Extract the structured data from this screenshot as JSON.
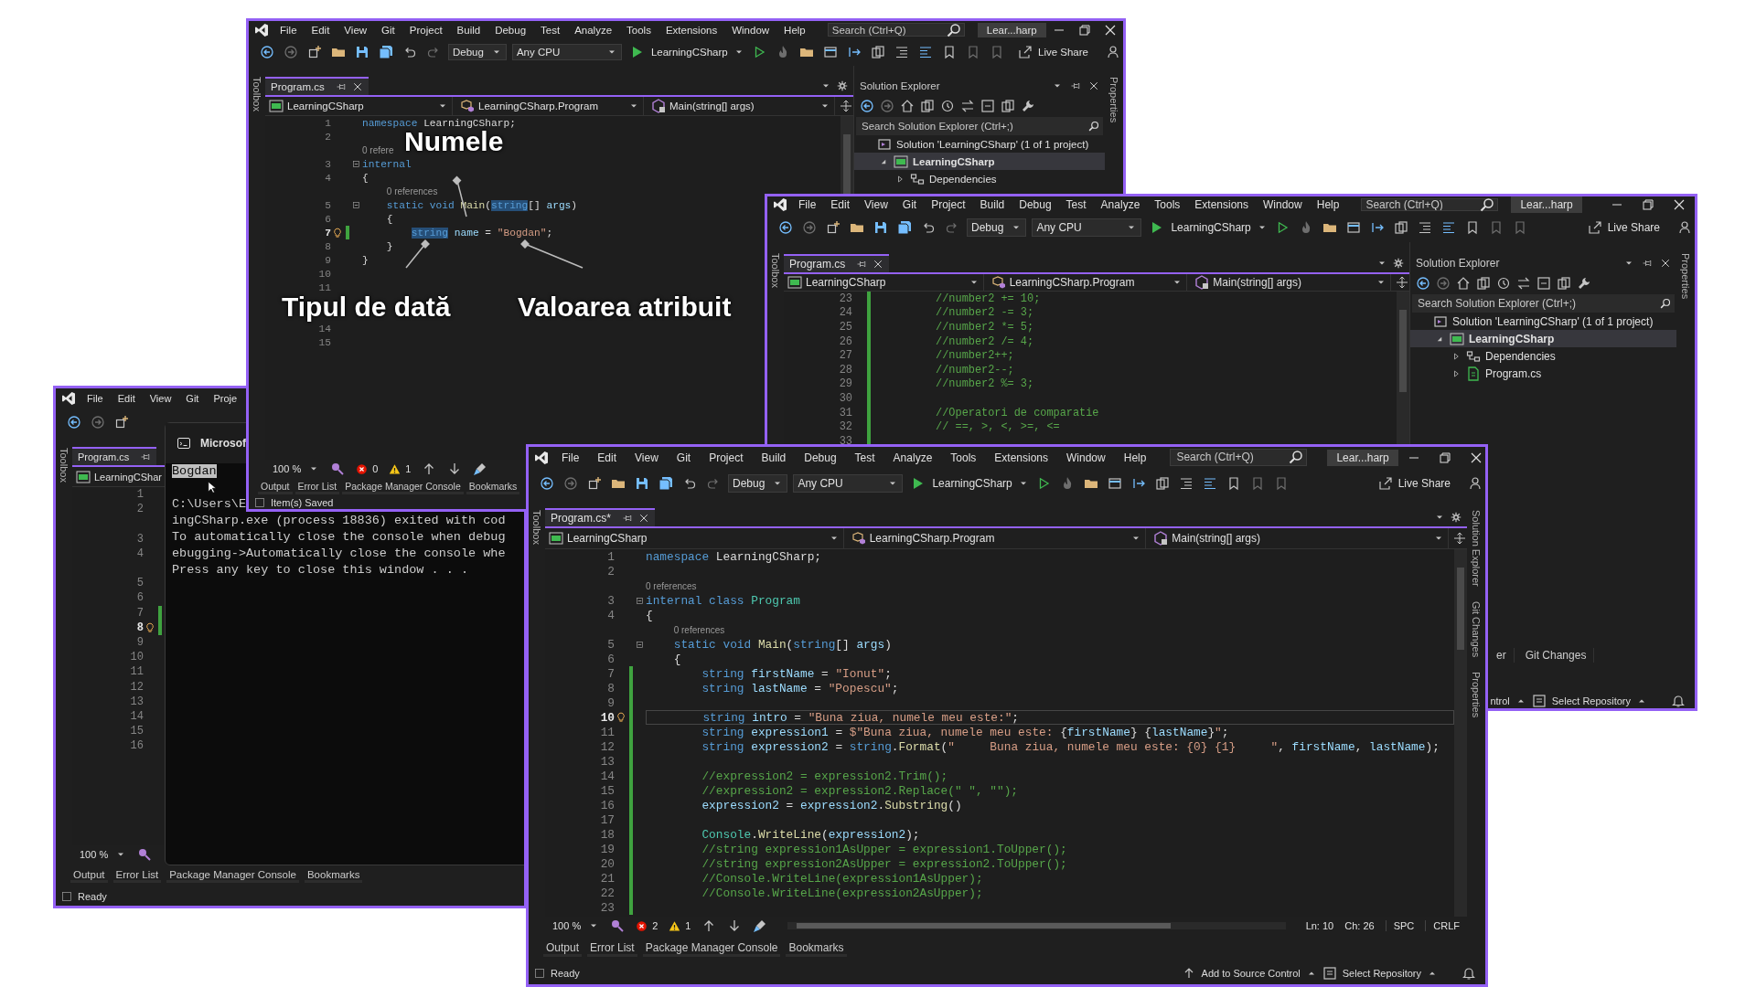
{
  "windows": [
    {
      "focused": false,
      "menu": [
        "File",
        "Edit",
        "View",
        "Git",
        "Project",
        "Build",
        "Debug",
        "Test",
        "Analyze",
        "Tools",
        "Extensions",
        "Window",
        "Help"
      ],
      "search_placeholder": "Search (Ctrl+Q)",
      "solution_name": "Lear...harp",
      "toolbar": {
        "configuration": "Debug",
        "platform": "Any CPU",
        "startup_project": "LearningCSharp",
        "live_share": "Live Share"
      },
      "left_strip": [
        "Toolbox"
      ],
      "right_strip": [
        "Properties"
      ],
      "document_tab": "Program.cs",
      "nav": [
        "LearningCSharp",
        "LearningCSharp.Program",
        "Main(string[] args)"
      ],
      "code": [
        {
          "num": "1",
          "code": [
            {
              "text": "namespace",
              "kind": "keyword"
            },
            {
              "text": " LearningCSharp;",
              "kind": "plain"
            }
          ],
          "changed": false
        },
        {
          "num": "2",
          "changed": false
        },
        {
          "lens": "0 refere"
        },
        {
          "num": "3",
          "code": [
            {
              "text": "internal",
              "kind": "keyword"
            }
          ],
          "fold": true,
          "changed": false
        },
        {
          "num": "4",
          "code": [
            {
              "text": "{",
              "kind": "plain"
            }
          ],
          "changed": false
        },
        {
          "lens": "0 references"
        },
        {
          "num": "5",
          "code": [
            {
              "text": "    static void ",
              "kind": "keyword"
            },
            {
              "text": "Main",
              "kind": "method"
            },
            {
              "text": "(",
              "kind": "plain"
            },
            {
              "text": "string",
              "kind": "highlight"
            },
            {
              "text": "[] ",
              "kind": "plain"
            },
            {
              "text": "args",
              "kind": "variable"
            },
            {
              "text": ")",
              "kind": "plain"
            }
          ],
          "fold": true,
          "changed": false
        },
        {
          "num": "6",
          "code": [
            {
              "text": "    {",
              "kind": "plain"
            }
          ],
          "changed": false
        },
        {
          "num": "7",
          "code": [
            {
              "text": "        string",
              "kind": "highlight"
            },
            {
              "text": " name",
              "kind": "variable"
            },
            {
              "text": " = ",
              "kind": "plain"
            },
            {
              "text": "\"Bogdan\"",
              "kind": "string"
            },
            {
              "text": ";",
              "kind": "plain"
            }
          ],
          "bulb": true,
          "current": true,
          "changed": true
        },
        {
          "num": "8",
          "code": [
            {
              "text": "    }",
              "kind": "plain"
            }
          ],
          "changed": false
        },
        {
          "num": "9",
          "code": [
            {
              "text": "}",
              "kind": "plain"
            }
          ],
          "changed": false
        },
        {
          "num": "10",
          "changed": false
        },
        {
          "num": "11",
          "changed": false
        },
        {
          "changed": false
        },
        {
          "changed": false
        },
        {
          "num": "14",
          "changed": false
        },
        {
          "num": "15",
          "changed": false
        }
      ],
      "editor_status": {
        "zoom": "100 %",
        "errors": "0",
        "warnings": "1"
      },
      "bottom_tabs": [
        "Output",
        "Error List",
        "Package Manager Console",
        "Bookmarks"
      ],
      "status_bar": {
        "message": "Item(s) Saved"
      },
      "solution_explorer": {
        "title": "Solution Explorer",
        "search_placeholder": "Search Solution Explorer (Ctrl+;)",
        "tree": [
          {
            "label": "Solution 'LearningCSharp' (1 of 1 project)",
            "kind": "solution",
            "selected": false,
            "children": [
              {
                "label": "LearningCSharp",
                "kind": "project",
                "selected": true,
                "expanded": true,
                "children": [
                  {
                    "label": "Dependencies",
                    "kind": "dependencies",
                    "selected": false,
                    "expanded": false
                  }
                ]
              }
            ]
          }
        ]
      },
      "annotations": [
        "Numele",
        "Tipul de dată",
        "Valoarea atribuit"
      ]
    },
    {
      "focused": false,
      "menu": [
        "File",
        "Edit",
        "View",
        "Git",
        "Project",
        "Build",
        "Debug",
        "Test",
        "Analyze",
        "Tools",
        "Extensions",
        "Window",
        "Help"
      ],
      "search_placeholder": "Search (Ctrl+Q)",
      "solution_name": "Lear...harp",
      "toolbar": {
        "configuration": "Debug",
        "platform": "Any CPU",
        "startup_project": "LearningCSharp",
        "live_share": "Live Share"
      },
      "left_strip": [
        "Toolbox"
      ],
      "right_strip": [
        "Properties"
      ],
      "document_tab": "Program.cs",
      "nav": [
        "LearningCSharp",
        "LearningCSharp.Program",
        "Main(string[] args)"
      ],
      "code": [
        {
          "num": "23",
          "code": [
            {
              "text": "        //number2 += 10;",
              "kind": "comment"
            }
          ],
          "changed": true
        },
        {
          "num": "24",
          "code": [
            {
              "text": "        //number2 -= 3;",
              "kind": "comment"
            }
          ],
          "changed": true
        },
        {
          "num": "25",
          "code": [
            {
              "text": "        //number2 *= 5;",
              "kind": "comment"
            }
          ],
          "changed": true
        },
        {
          "num": "26",
          "code": [
            {
              "text": "        //number2 /= 4;",
              "kind": "comment"
            }
          ],
          "changed": true
        },
        {
          "num": "27",
          "code": [
            {
              "text": "        //number2++;",
              "kind": "comment"
            }
          ],
          "changed": true
        },
        {
          "num": "28",
          "code": [
            {
              "text": "        //number2--;",
              "kind": "comment"
            }
          ],
          "changed": true
        },
        {
          "num": "29",
          "code": [
            {
              "text": "        //number2 %= 3;",
              "kind": "comment"
            }
          ],
          "changed": true
        },
        {
          "num": "30",
          "changed": true
        },
        {
          "num": "31",
          "code": [
            {
              "text": "        //Operatori de comparatie",
              "kind": "comment"
            }
          ],
          "changed": true
        },
        {
          "num": "32",
          "code": [
            {
              "text": "        // ==, >, <, >=, <=",
              "kind": "comment"
            }
          ],
          "changed": true
        },
        {
          "num": "33",
          "changed": true
        }
      ],
      "status_bar": {
        "items": [
          {
            "text": "ntrol",
            "kind": "truncated"
          },
          {
            "text": "Select Repository",
            "kind": "repository"
          }
        ]
      },
      "solution_explorer": {
        "title": "Solution Explorer",
        "search_placeholder": "Search Solution Explorer (Ctrl+;)",
        "tree": [
          {
            "label": "Solution 'LearningCSharp' (1 of 1 project)",
            "kind": "solution",
            "selected": false,
            "children": [
              {
                "label": "LearningCSharp",
                "kind": "project",
                "selected": true,
                "expanded": true,
                "children": [
                  {
                    "label": "Dependencies",
                    "kind": "dependencies",
                    "selected": false,
                    "expanded": false
                  },
                  {
                    "label": "Program.cs",
                    "kind": "file",
                    "selected": false,
                    "expanded": false
                  }
                ]
              }
            ]
          }
        ],
        "bottom_tabs": [
          "er",
          "Git Changes"
        ]
      }
    },
    {
      "focused": false,
      "menu": [
        "File",
        "Edit",
        "View",
        "Git",
        "Proje"
      ],
      "left_strip": [
        "Toolbox"
      ],
      "document_tab": "Program.cs",
      "nav": [
        "LearningCShar"
      ],
      "code": [
        {
          "num": "1",
          "changed": false
        },
        {
          "num": "2",
          "changed": false
        },
        {
          "changed": false
        },
        {
          "num": "3",
          "changed": false
        },
        {
          "num": "4",
          "changed": false
        },
        {
          "changed": false
        },
        {
          "num": "5",
          "changed": false
        },
        {
          "num": "6",
          "changed": false
        },
        {
          "num": "7",
          "changed": true
        },
        {
          "num": "8",
          "changed": true,
          "bulb": true,
          "current": true
        },
        {
          "num": "9",
          "changed": false
        },
        {
          "num": "10",
          "changed": false
        },
        {
          "num": "11",
          "changed": false
        },
        {
          "num": "12",
          "changed": false
        },
        {
          "num": "13",
          "changed": false
        },
        {
          "num": "14",
          "changed": false
        },
        {
          "num": "15",
          "changed": false
        },
        {
          "num": "16",
          "changed": false
        }
      ],
      "editor_status": {
        "zoom": "100 %"
      },
      "bottom_tabs": [
        "Output",
        "Error List",
        "Package Manager Console",
        "Bookmarks"
      ],
      "status_bar": {
        "message": "Ready"
      },
      "console": {
        "title": "Microsof",
        "lines": [
          {
            "text": "Bogdan",
            "selected": true
          },
          {
            "text": "C:\\Users\\E",
            "selected": false
          },
          {
            "text": "ingCSharp.exe (process 18836) exited with cod",
            "selected": false
          },
          {
            "text": "To automatically close the console when debug",
            "selected": false
          },
          {
            "text": "ebugging->Automatically close the console whe",
            "selected": false
          },
          {
            "text": "Press any key to close this window . . .",
            "selected": false
          }
        ]
      }
    },
    {
      "focused": true,
      "menu": [
        "File",
        "Edit",
        "View",
        "Git",
        "Project",
        "Build",
        "Debug",
        "Test",
        "Analyze",
        "Tools",
        "Extensions",
        "Window",
        "Help"
      ],
      "search_placeholder": "Search (Ctrl+Q)",
      "solution_name": "Lear...harp",
      "toolbar": {
        "configuration": "Debug",
        "platform": "Any CPU",
        "startup_project": "LearningCSharp",
        "live_share": "Live Share"
      },
      "left_strip": [
        "Toolbox"
      ],
      "right_strip": [
        "Solution Explorer",
        "Git Changes",
        "Properties"
      ],
      "document_tab": "Program.cs*",
      "nav": [
        "LearningCSharp",
        "LearningCSharp.Program",
        "Main(string[] args)"
      ],
      "code": [
        {
          "num": "1",
          "code": [
            {
              "text": "namespace",
              "kind": "keyword"
            },
            {
              "text": " LearningCSharp;",
              "kind": "plain"
            }
          ],
          "changed": false
        },
        {
          "num": "2",
          "changed": false
        },
        {
          "lens": "0 references"
        },
        {
          "num": "3",
          "code": [
            {
              "text": "internal class ",
              "kind": "keyword"
            },
            {
              "text": "Program",
              "kind": "type"
            }
          ],
          "fold": true,
          "changed": false
        },
        {
          "num": "4",
          "code": [
            {
              "text": "{",
              "kind": "plain"
            }
          ],
          "changed": false
        },
        {
          "lens": "0 references"
        },
        {
          "num": "5",
          "code": [
            {
              "text": "    static void ",
              "kind": "keyword"
            },
            {
              "text": "Main",
              "kind": "method"
            },
            {
              "text": "(",
              "kind": "plain"
            },
            {
              "text": "string",
              "kind": "keyword"
            },
            {
              "text": "[] ",
              "kind": "plain"
            },
            {
              "text": "args",
              "kind": "variable"
            },
            {
              "text": ")",
              "kind": "plain"
            }
          ],
          "fold": true,
          "changed": false
        },
        {
          "num": "6",
          "code": [
            {
              "text": "    {",
              "kind": "plain"
            }
          ],
          "changed": false
        },
        {
          "num": "7",
          "code": [
            {
              "text": "        string",
              "kind": "keyword"
            },
            {
              "text": " firstName",
              "kind": "variable"
            },
            {
              "text": " = ",
              "kind": "plain"
            },
            {
              "text": "\"Ionut\"",
              "kind": "string"
            },
            {
              "text": ";",
              "kind": "plain"
            }
          ],
          "changed": true
        },
        {
          "num": "8",
          "code": [
            {
              "text": "        string",
              "kind": "keyword"
            },
            {
              "text": " lastName",
              "kind": "variable"
            },
            {
              "text": " = ",
              "kind": "plain"
            },
            {
              "text": "\"Popescu\"",
              "kind": "string"
            },
            {
              "text": ";",
              "kind": "plain"
            }
          ],
          "changed": true
        },
        {
          "num": "9",
          "changed": true
        },
        {
          "num": "10",
          "code": [
            {
              "text": "        string",
              "kind": "keyword"
            },
            {
              "text": " intro",
              "kind": "variable"
            },
            {
              "text": " = ",
              "kind": "plain"
            },
            {
              "text": "\"Buna ziua, numele meu este:\"",
              "kind": "string"
            },
            {
              "text": ";",
              "kind": "plain"
            }
          ],
          "changed": true,
          "bulb": true,
          "current": true
        },
        {
          "num": "11",
          "code": [
            {
              "text": "        string",
              "kind": "keyword"
            },
            {
              "text": " expression1",
              "kind": "variable"
            },
            {
              "text": " = ",
              "kind": "plain"
            },
            {
              "text": "$\"Buna ziua, numele meu este: ",
              "kind": "string"
            },
            {
              "text": "{",
              "kind": "plain"
            },
            {
              "text": "firstName",
              "kind": "variable"
            },
            {
              "text": "} {",
              "kind": "plain"
            },
            {
              "text": "lastName",
              "kind": "variable"
            },
            {
              "text": "}",
              "kind": "plain"
            },
            {
              "text": "\"",
              "kind": "string"
            },
            {
              "text": ";",
              "kind": "plain"
            }
          ],
          "changed": true
        },
        {
          "num": "12",
          "code": [
            {
              "text": "        string",
              "kind": "keyword"
            },
            {
              "text": " expression2",
              "kind": "variable"
            },
            {
              "text": " = ",
              "kind": "plain"
            },
            {
              "text": "string",
              "kind": "keyword"
            },
            {
              "text": ".",
              "kind": "plain"
            },
            {
              "text": "Format",
              "kind": "method"
            },
            {
              "text": "(",
              "kind": "plain"
            },
            {
              "text": "\"     Buna ziua, numele meu este: {0} {1}     \"",
              "kind": "string"
            },
            {
              "text": ", ",
              "kind": "plain"
            },
            {
              "text": "firstName",
              "kind": "variable"
            },
            {
              "text": ", ",
              "kind": "plain"
            },
            {
              "text": "lastName",
              "kind": "variable"
            },
            {
              "text": ");",
              "kind": "plain"
            }
          ],
          "changed": true
        },
        {
          "num": "13",
          "changed": true
        },
        {
          "num": "14",
          "code": [
            {
              "text": "        //expression2 = expression2.Trim();",
              "kind": "comment"
            }
          ],
          "changed": true
        },
        {
          "num": "15",
          "code": [
            {
              "text": "        //expression2 = expression2.Replace(\" \", \"\");",
              "kind": "comment"
            }
          ],
          "changed": true
        },
        {
          "num": "16",
          "code": [
            {
              "text": "        expression2",
              "kind": "variable"
            },
            {
              "text": " = ",
              "kind": "plain"
            },
            {
              "text": "expression2",
              "kind": "variable"
            },
            {
              "text": ".",
              "kind": "plain"
            },
            {
              "text": "Substring",
              "kind": "method"
            },
            {
              "text": "()",
              "kind": "plain"
            }
          ],
          "changed": true
        },
        {
          "num": "17",
          "changed": true
        },
        {
          "num": "18",
          "code": [
            {
              "text": "        Console",
              "kind": "type"
            },
            {
              "text": ".",
              "kind": "plain"
            },
            {
              "text": "WriteLine",
              "kind": "method"
            },
            {
              "text": "(",
              "kind": "plain"
            },
            {
              "text": "expression2",
              "kind": "variable"
            },
            {
              "text": ");",
              "kind": "plain"
            }
          ],
          "changed": true
        },
        {
          "num": "19",
          "code": [
            {
              "text": "        //string expression1AsUpper = expression1.ToUpper();",
              "kind": "comment"
            }
          ],
          "changed": true
        },
        {
          "num": "20",
          "code": [
            {
              "text": "        //string expression2AsUpper = expression2.ToUpper();",
              "kind": "comment"
            }
          ],
          "changed": true
        },
        {
          "num": "21",
          "code": [
            {
              "text": "        //Console.WriteLine(expression1AsUpper);",
              "kind": "comment"
            }
          ],
          "changed": true
        },
        {
          "num": "22",
          "code": [
            {
              "text": "        //Console.WriteLine(expression2AsUpper);",
              "kind": "comment"
            }
          ],
          "changed": true
        },
        {
          "num": "23",
          "changed": true
        }
      ],
      "editor_status": {
        "zoom": "100 %",
        "errors": "2",
        "warnings": "1",
        "line": "Ln: 10",
        "column": "Ch: 26",
        "indent": "SPC",
        "line_ending": "CRLF"
      },
      "bottom_tabs": [
        "Output",
        "Error List",
        "Package Manager Console",
        "Bookmarks"
      ],
      "status_bar": {
        "message": "Ready",
        "items": [
          {
            "text": "Add to Source Control",
            "kind": "source-control"
          },
          {
            "text": "Select Repository",
            "kind": "repository"
          }
        ]
      }
    }
  ]
}
